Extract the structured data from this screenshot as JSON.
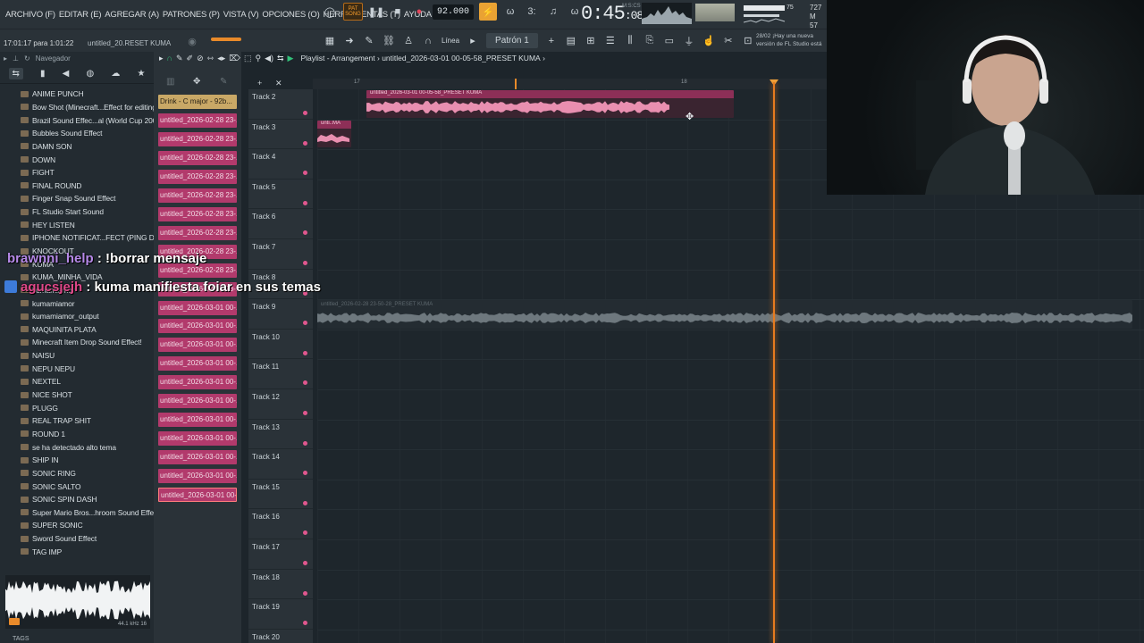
{
  "menu": [
    "ARCHIVO (F)",
    "EDITAR (E)",
    "AGREGAR (A)",
    "PATRONES (P)",
    "VISTA (V)",
    "OPCIONES (O)",
    "HERRAMIENTAS (T)",
    "AYUDA"
  ],
  "transport": {
    "song_label": "SONG",
    "pat_label": "PAT",
    "tempo": "92.000",
    "time_main": "0:45",
    "time_small": ":08",
    "time_unit": "M:S:CS",
    "cpu_value": "75",
    "memory": [
      "727 M",
      "57"
    ]
  },
  "toolbar2": {
    "clock": "17:01:17 para 1:01:22",
    "project": "untitled_20.RESET KUMA",
    "line_mode": "Línea",
    "pattern": "Patrón 1",
    "news": [
      "28/02  ¡Hay una nueva",
      "versión de FL Studio está"
    ]
  },
  "browser": {
    "title": "Navegador",
    "items": [
      "ANIME PUNCH",
      "Bow Shot (Minecraft...Effect for editing",
      "Brazil Sound Effec...al (World Cup 2002)",
      "Bubbles Sound Effect",
      "DAMN SON",
      "DOWN",
      "FIGHT",
      "FINAL ROUND",
      "Finger Snap Sound Effect",
      "FL Studio Start Sound",
      "HEY LISTEN",
      "IPHONE NOTIFICAT...FECT (PING DING)",
      "KNOCKOUT",
      "KUMA",
      "KUMA_MINHA_VIDA",
      "kumamiamor",
      "kumamiamor",
      "kumamiamor_output",
      "MAQUINITA PLATA",
      "Minecraft Item Drop Sound Effect!",
      "NAISU",
      "NEPU NEPU",
      "NEXTEL",
      "NICE SHOT",
      "PLUGG",
      "REAL TRAP SHIT",
      "ROUND 1",
      "se ha detectado alto tema",
      "SHIP IN",
      "SONIC RING",
      "SONIC SALTO",
      "SONIC SPIN DASH",
      "Super Mario Bros...hroom Sound Effect",
      "SUPER SONIC",
      "Sword Sound Effect",
      "TAG IMP"
    ],
    "preview_info": "44.1 kHz 16",
    "tags_label": "TAGS"
  },
  "clips": {
    "first": "Drink - C major - 92b...",
    "items": [
      "untitled_2026-02-28 23-...",
      "untitled_2026-02-28 23-...",
      "untitled_2026-02-28 23-...",
      "untitled_2026-02-28 23-...",
      "untitled_2026-02-28 23-...",
      "untitled_2026-02-28 23-...",
      "untitled_2026-02-28 23-...",
      "untitled_2026-02-28 23-...",
      "untitled_2026-02-28 23-...",
      "untitled_2026-02-28 23-...",
      "untitled_2026-03-01 00-...",
      "untitled_2026-03-01 00-...",
      "untitled_2026-03-01 00-...",
      "untitled_2026-03-01 00-...",
      "untitled_2026-03-01 00-...",
      "untitled_2026-03-01 00-...",
      "untitled_2026-03-01 00-...",
      "untitled_2026-03-01 00-...",
      "untitled_2026-03-01 00-...",
      "untitled_2026-03-01 00-...",
      "untitled_2026-03-01 00-..."
    ]
  },
  "playlist": {
    "title": "Playlist - Arrangement",
    "project": "untitled_2026-03-01 00-05-58_PRESET KUMA",
    "bar_17": "17",
    "bar_18": "18",
    "tracks": [
      "Track 2",
      "Track 3",
      "Track 4",
      "Track 5",
      "Track 6",
      "Track 7",
      "Track 8",
      "Track 9",
      "Track 10",
      "Track 11",
      "Track 12",
      "Track 13",
      "Track 14",
      "Track 15",
      "Track 16",
      "Track 17",
      "Track 18",
      "Track 19",
      "Track 20"
    ],
    "clip_main": "untitled_2026-03-01 00-05-58_PRESET KUMA",
    "clip_small": "unti..MA",
    "clip_long": "untitled_2026-02-28 23-50-28_PRESET KUMA"
  },
  "chat": [
    {
      "user": "brawnni_help",
      "text": ": !borrar mensaje"
    },
    {
      "user": "agucsjejh",
      "text": ": kuma manifiesta foiar en sus temas"
    }
  ],
  "colors": {
    "accent": "#e77b1f",
    "clip": "#b23a6c",
    "waveform": "#e98fb0"
  }
}
